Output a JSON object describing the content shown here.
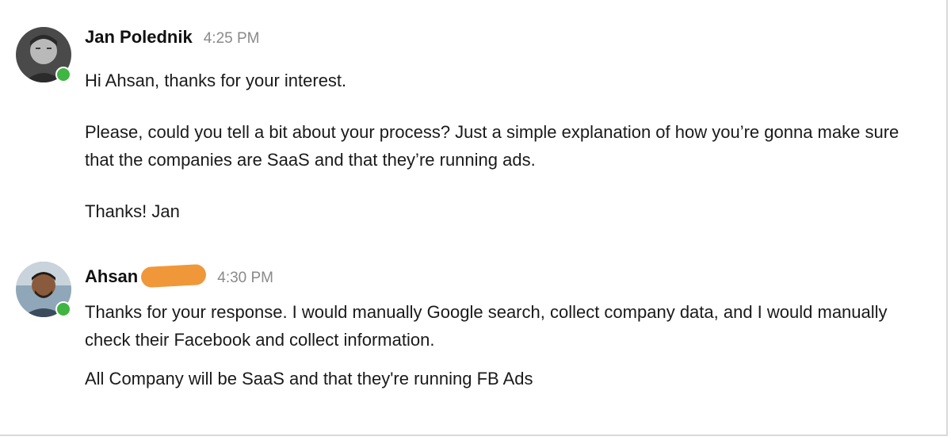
{
  "messages": [
    {
      "author": "Jan Polednik",
      "time": "4:25 PM",
      "paragraphs": [
        "Hi Ahsan, thanks for your interest.",
        "Please, could you tell a bit about your process? Just a simple explanation of how you’re gonna make sure that the companies are SaaS and that they’re running ads.",
        "Thanks! Jan"
      ],
      "online": true
    },
    {
      "author": "Ahsan",
      "time": "4:30 PM",
      "paragraphs": [
        "Thanks for your response. I would manually Google search, collect company data, and I would manually check their Facebook and collect information.",
        "All Company will be SaaS and that they're running FB Ads"
      ],
      "online": true
    }
  ],
  "colors": {
    "presence": "#3fb542",
    "redaction": "#f0973a",
    "timestamp": "#8a8a8a"
  }
}
